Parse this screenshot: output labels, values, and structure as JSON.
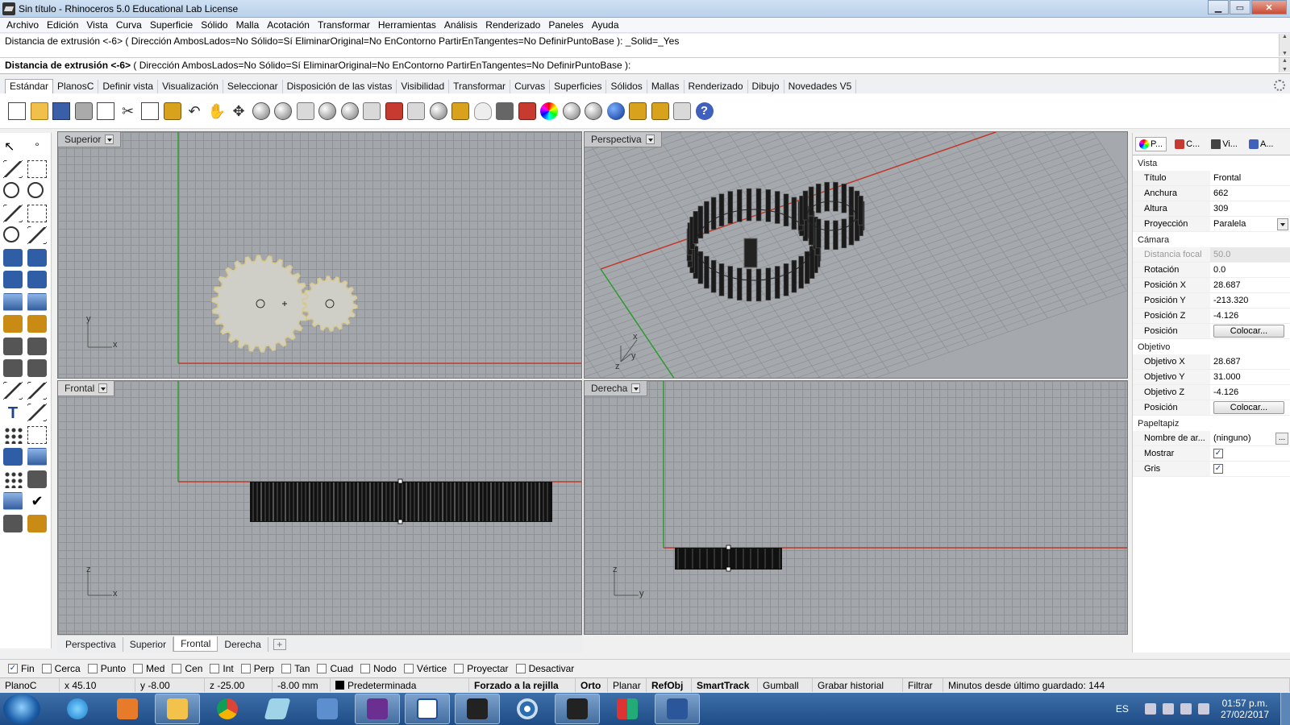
{
  "window": {
    "title": "Sin título - Rhinoceros 5.0 Educational Lab License"
  },
  "menu": [
    "Archivo",
    "Edición",
    "Vista",
    "Curva",
    "Superficie",
    "Sólido",
    "Malla",
    "Acotación",
    "Transformar",
    "Herramientas",
    "Análisis",
    "Renderizado",
    "Paneles",
    "Ayuda"
  ],
  "command": {
    "history_line": "Distancia de extrusión <-6> ( Dirección  AmbosLados=No  Sólido=Sí  EliminarOriginal=No  EnContorno  PartirEnTangentes=No  DefinirPuntoBase ): _Solid=_Yes",
    "prompt_label": "Distancia de extrusión <-6>",
    "prompt_options": " ( Dirección  AmbosLados=No  Sólido=Sí  EliminarOriginal=No  EnContorno  PartirEnTangentes=No  DefinirPuntoBase ):"
  },
  "toolbar_tabs": [
    "Estándar",
    "PlanosC",
    "Definir vista",
    "Visualización",
    "Seleccionar",
    "Disposición de las vistas",
    "Visibilidad",
    "Transformar",
    "Curvas",
    "Superficies",
    "Sólidos",
    "Mallas",
    "Renderizado",
    "Dibujo",
    "Novedades V5"
  ],
  "viewports": {
    "superior": {
      "label": "Superior",
      "axis_y": "y",
      "axis_x": "x"
    },
    "perspectiva": {
      "label": "Perspectiva",
      "axis_x": "x",
      "axis_y": "y",
      "axis_z": "z"
    },
    "frontal": {
      "label": "Frontal",
      "axis_y": "z",
      "axis_x": "x"
    },
    "derecha": {
      "label": "Derecha",
      "axis_y": "z",
      "axis_x": "y"
    }
  },
  "viewport_tabs": [
    "Perspectiva",
    "Superior",
    "Frontal",
    "Derecha"
  ],
  "viewport_tabs_plus": "+",
  "panel": {
    "tabs": [
      "P...",
      "C...",
      "Vi...",
      "A..."
    ],
    "section_vista": "Vista",
    "titulo_label": "Título",
    "titulo": "Frontal",
    "anchura_label": "Anchura",
    "anchura": "662",
    "altura_label": "Altura",
    "altura": "309",
    "proyeccion_label": "Proyección",
    "proyeccion": "Paralela",
    "section_camara": "Cámara",
    "focal_label": "Distancia focal",
    "focal": "50.0",
    "rotacion_label": "Rotación",
    "rotacion": "0.0",
    "posx_label": "Posición X",
    "posx": "28.687",
    "posy_label": "Posición Y",
    "posy": "-213.320",
    "posz_label": "Posición Z",
    "posz": "-4.126",
    "posicion_label": "Posición",
    "colocar": "Colocar...",
    "section_objetivo": "Objetivo",
    "objx_label": "Objetivo X",
    "objx": "28.687",
    "objy_label": "Objetivo Y",
    "objy": "31.000",
    "objz_label": "Objetivo Z",
    "objz": "-4.126",
    "posicion2_label": "Posición",
    "colocar2": "Colocar...",
    "section_papel": "Papeltapiz",
    "archivo_label": "Nombre de ar...",
    "archivo": "(ninguno)",
    "dots": "...",
    "mostrar_label": "Mostrar",
    "mostrar": true,
    "gris_label": "Gris",
    "gris": true,
    "check_glyph": "✓"
  },
  "osnaps": [
    {
      "label": "Fin",
      "checked": true
    },
    {
      "label": "Cerca",
      "checked": false
    },
    {
      "label": "Punto",
      "checked": false
    },
    {
      "label": "Med",
      "checked": false
    },
    {
      "label": "Cen",
      "checked": false
    },
    {
      "label": "Int",
      "checked": false
    },
    {
      "label": "Perp",
      "checked": false
    },
    {
      "label": "Tan",
      "checked": false
    },
    {
      "label": "Cuad",
      "checked": false
    },
    {
      "label": "Nodo",
      "checked": false
    },
    {
      "label": "Vértice",
      "checked": false
    },
    {
      "label": "Proyectar",
      "checked": false
    },
    {
      "label": "Desactivar",
      "checked": false
    }
  ],
  "status": {
    "cplane": "PlanoC",
    "x": "x 45.10",
    "y": "y -8.00",
    "z": "z -25.00",
    "dist": "-8.00 mm",
    "layer": "Predeterminada",
    "grid_snap": "Forzado a la rejilla",
    "ortho": "Orto",
    "planar": "Planar",
    "osnap": "RefObj",
    "smarttrack": "SmartTrack",
    "gumball": "Gumball",
    "history": "Grabar historial",
    "filter": "Filtrar",
    "saved": "Minutos desde último guardado: 144"
  },
  "taskbar": {
    "lang": "ES",
    "time": "01:57 p.m.",
    "date": "27/02/2017"
  },
  "colors": {
    "x_axis": "#c0392b",
    "y_axis": "#2e9a2e",
    "gear_fill": "#cfcfc7",
    "gear_stroke": "#d9c98a"
  }
}
